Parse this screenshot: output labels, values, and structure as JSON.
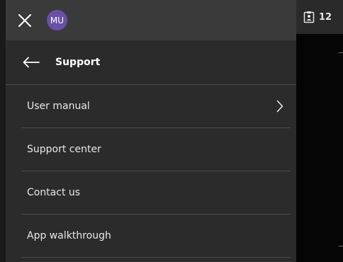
{
  "header": {
    "close_icon": "close-icon",
    "avatar_initials": "MU",
    "avatar_color": "#6a4fa6"
  },
  "side_panel": {
    "clipboard_icon": "clipboard-person-icon",
    "count": "12"
  },
  "submenu": {
    "back_icon": "arrow-left-icon",
    "title": "Support",
    "items": [
      {
        "label": "User manual",
        "has_chevron": true
      },
      {
        "label": "Support center",
        "has_chevron": false
      },
      {
        "label": "Contact us",
        "has_chevron": false
      },
      {
        "label": "App walkthrough",
        "has_chevron": false
      }
    ]
  }
}
